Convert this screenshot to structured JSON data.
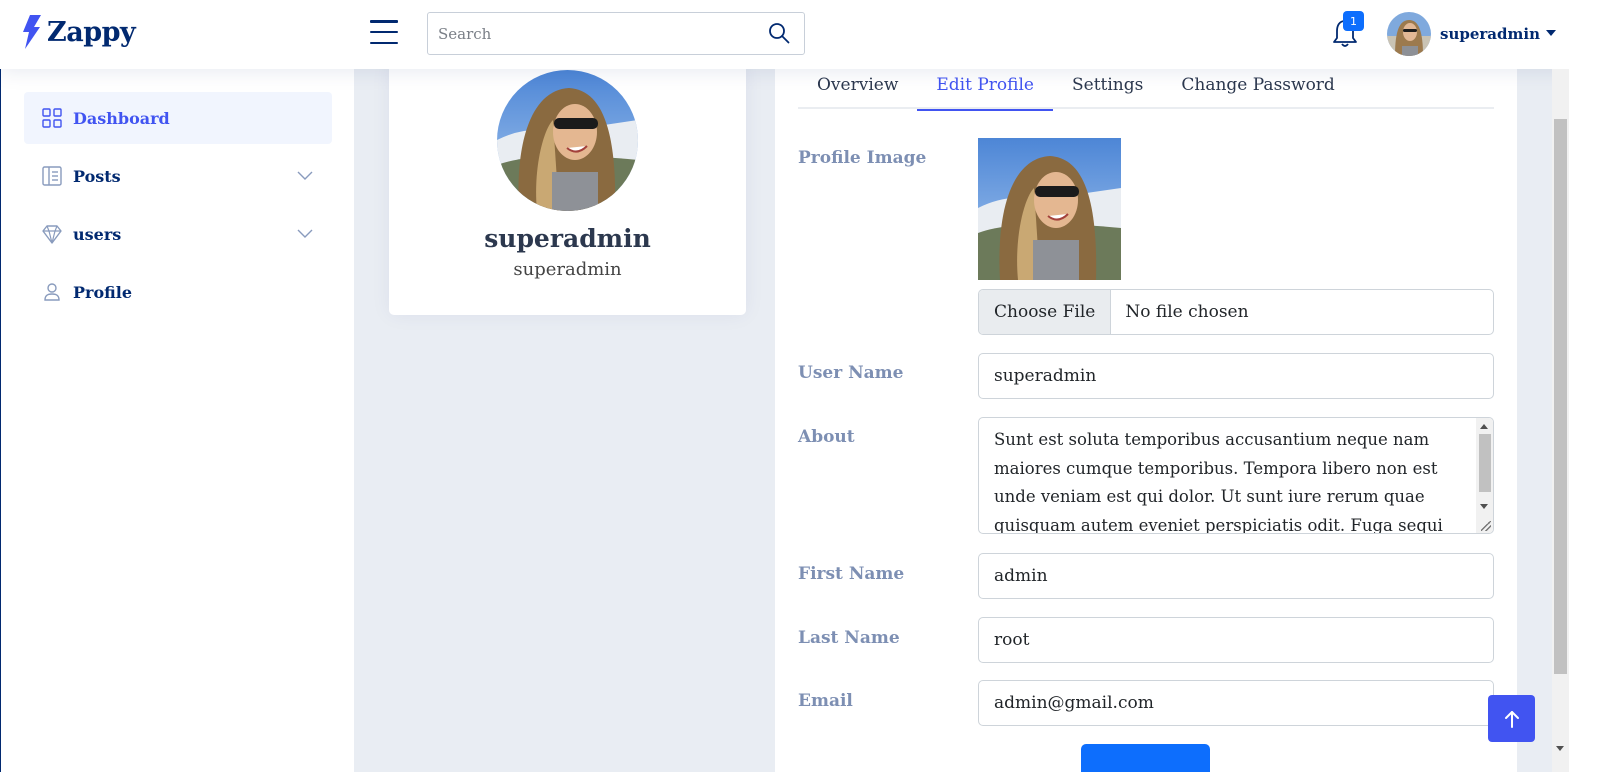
{
  "app": {
    "name": "Zappy"
  },
  "header": {
    "search": {
      "placeholder": "Search",
      "value": ""
    },
    "notifications": {
      "count": "1"
    },
    "user": {
      "name": "superadmin"
    }
  },
  "sidebar": {
    "items": [
      {
        "label": "Dashboard",
        "icon": "grid-icon",
        "active": true
      },
      {
        "label": "Posts",
        "icon": "layout-text-icon",
        "expandable": true
      },
      {
        "label": "users",
        "icon": "gem-icon",
        "expandable": true
      },
      {
        "label": "Profile",
        "icon": "person-icon"
      }
    ]
  },
  "profile_card": {
    "name": "superadmin",
    "subtitle": "superadmin"
  },
  "tabs": [
    {
      "label": "Overview"
    },
    {
      "label": "Edit Profile",
      "active": true
    },
    {
      "label": "Settings"
    },
    {
      "label": "Change Password"
    }
  ],
  "form": {
    "profile_image": {
      "label": "Profile Image",
      "choose_label": "Choose File",
      "file_status": "No file chosen"
    },
    "username": {
      "label": "User Name",
      "value": "superadmin"
    },
    "about": {
      "label": "About",
      "value": "Sunt est soluta temporibus accusantium neque nam maiores cumque temporibus. Tempora libero non est unde veniam est qui dolor. Ut sunt iure rerum quae quisquam autem eveniet perspiciatis odit. Fuga sequi sed ea saepe at unde."
    },
    "first_name": {
      "label": "First Name",
      "value": "admin"
    },
    "last_name": {
      "label": "Last Name",
      "value": "root"
    },
    "email": {
      "label": "Email",
      "value": "admin@gmail.com"
    },
    "submit_label": ""
  },
  "colors": {
    "brand": "#012970",
    "accent": "#4154f1",
    "primary_button": "#0d6efd",
    "label": "#7d8fb3",
    "background": "#e9edf3"
  }
}
